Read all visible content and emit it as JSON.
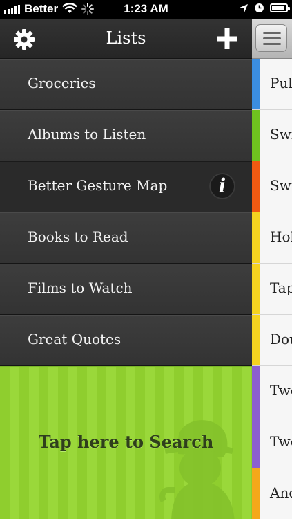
{
  "status_bar": {
    "carrier": "Better",
    "time": "1:23 AM"
  },
  "nav": {
    "title": "Lists",
    "settings_icon": "gear-icon",
    "add_icon": "plus-icon"
  },
  "lists": [
    {
      "label": "Groceries"
    },
    {
      "label": "Albums to Listen"
    },
    {
      "label": "Better Gesture Map",
      "selected": true,
      "info": "i"
    },
    {
      "label": "Books to Read"
    },
    {
      "label": "Films to Watch"
    },
    {
      "label": "Great Quotes"
    }
  ],
  "search": {
    "label": "Tap here to Search"
  },
  "right_panel": {
    "menu_icon": "menu-icon",
    "items": [
      {
        "text": "Pul",
        "color": "#3b8de0"
      },
      {
        "text": "Swi",
        "color": "#6fc21f"
      },
      {
        "text": "Swi",
        "color": "#f05a12"
      },
      {
        "text": "Hol",
        "color": "#f5d320"
      },
      {
        "text": "Tap",
        "color": "#f5d320"
      },
      {
        "text": "Dou",
        "color": "#f5d320"
      },
      {
        "text": "Two",
        "color": "#8c5fd0"
      },
      {
        "text": "Two",
        "color": "#8c5fd0"
      },
      {
        "text": "And",
        "color": "#f5a81a"
      }
    ]
  }
}
